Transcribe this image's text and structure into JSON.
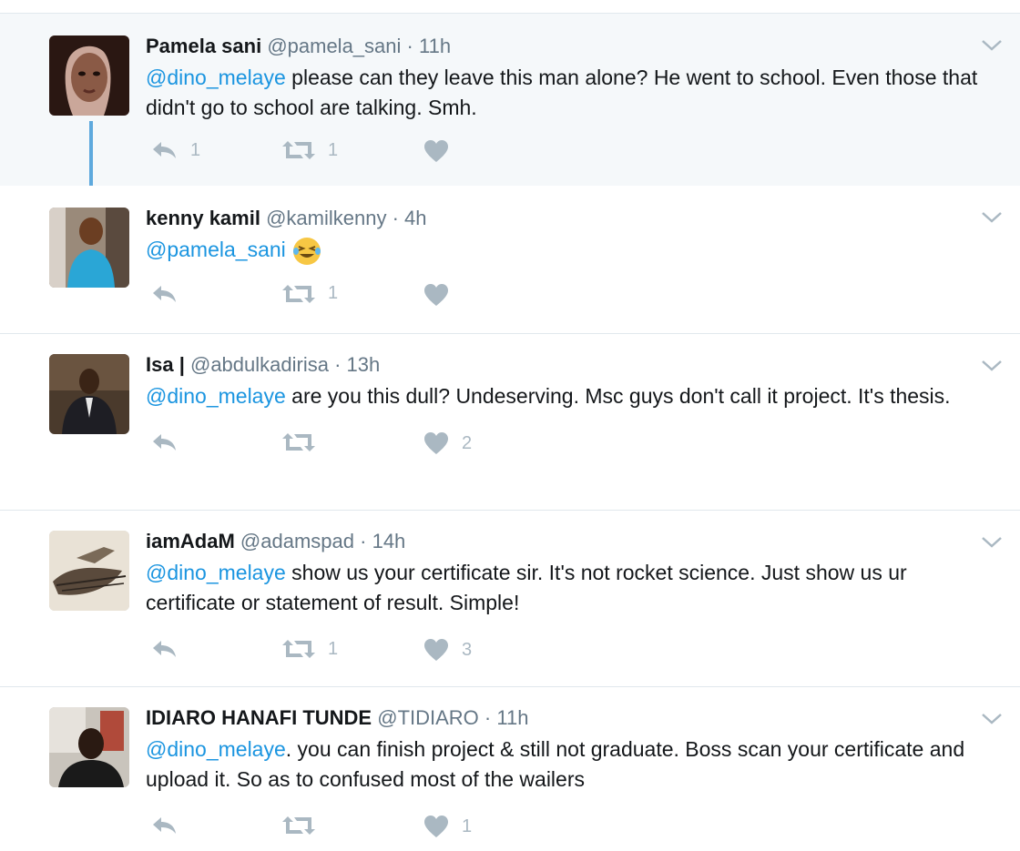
{
  "tweets": [
    {
      "name": "Pamela sani",
      "handle": "@pamela_sani",
      "time": "11h",
      "mention": "@dino_melaye",
      "text": " please can they leave this man alone? He went to school. Even those that didn't go to school are talking. Smh.",
      "replies": "1",
      "retweets": "1",
      "likes": ""
    },
    {
      "name": "kenny kamil",
      "handle": "@kamilkenny",
      "time": "4h",
      "mention": "@pamela_sani",
      "text": "",
      "emoji": "laughing-tears-emoji",
      "replies": "",
      "retweets": "1",
      "likes": ""
    },
    {
      "name": "Isa |",
      "handle": "@abdulkadirisa",
      "time": "13h",
      "mention": "@dino_melaye",
      "text": " are you this dull? Undeserving. Msc guys don't call it project. It's thesis.",
      "replies": "",
      "retweets": "",
      "likes": "2"
    },
    {
      "name": "iamAdaM",
      "handle": "@adamspad",
      "time": "14h",
      "mention": "@dino_melaye",
      "text": " show us your certificate sir. It's not rocket science. Just show us ur certificate or statement of result. Simple!",
      "replies": "",
      "retweets": "1",
      "likes": "3"
    },
    {
      "name": "IDIARO HANAFI TUNDE",
      "handle": "@TIDIARO",
      "time": "11h",
      "mention": "@dino_melaye",
      "text": ". you can finish project & still not graduate. Boss scan your certificate and upload it. So as to confused most of the wailers",
      "replies": "",
      "retweets": "",
      "likes": "1"
    }
  ],
  "separator": "·",
  "icons": {
    "reply": "reply-icon",
    "retweet": "retweet-icon",
    "like": "heart-icon",
    "menu": "chevron-down-icon"
  },
  "colors": {
    "mention": "#1b95e0",
    "action": "#aab8c2",
    "thread": "#5ea9dd",
    "highlight": "#f5f8fa"
  }
}
